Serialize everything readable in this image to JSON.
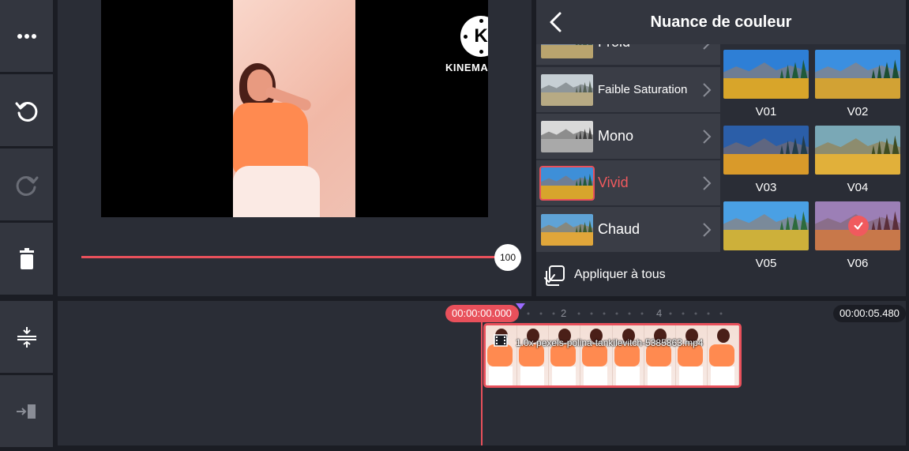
{
  "left_toolbar": {
    "items": [
      {
        "icon": "more-icon"
      },
      {
        "icon": "undo-icon"
      },
      {
        "icon": "redo-icon"
      },
      {
        "icon": "delete-icon"
      },
      {
        "icon": "expand-timeline-icon"
      },
      {
        "icon": "jump-to-end-icon"
      }
    ]
  },
  "preview": {
    "watermark": "KINEMASTER",
    "logo_letter": "K",
    "slider_value": "100"
  },
  "panel": {
    "title": "Nuance de couleur",
    "categories": [
      {
        "label": "Froid",
        "selected": false
      },
      {
        "label": "Faible Saturation",
        "selected": false
      },
      {
        "label": "Mono",
        "selected": false
      },
      {
        "label": "Vivid",
        "selected": true
      },
      {
        "label": "Chaud",
        "selected": false
      }
    ],
    "apply_all": "Appliquer à tous",
    "presets": [
      {
        "label": "V01",
        "selected": false
      },
      {
        "label": "V02",
        "selected": false
      },
      {
        "label": "V03",
        "selected": false
      },
      {
        "label": "V04",
        "selected": false
      },
      {
        "label": "V05",
        "selected": false
      },
      {
        "label": "V06",
        "selected": true
      }
    ]
  },
  "timeline": {
    "current_time": "00:00:00.000",
    "end_time": "00:00:05.480",
    "ruler_labels": [
      "2",
      "4"
    ],
    "clip_name": "1.0x pexels-polina-tankilevitch-5385863.mp4"
  },
  "colors": {
    "accent": "#e8505b",
    "panel_bg": "#2a2d36",
    "button_bg": "#33363f",
    "app_bg": "#1b1d24"
  }
}
